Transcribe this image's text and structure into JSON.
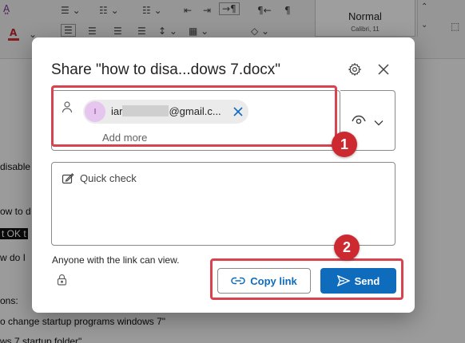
{
  "background_document": {
    "style_gallery": {
      "style_name": "Normal",
      "style_font": "Calibri, 11"
    },
    "lines": [
      {
        "text": "disable"
      },
      {
        "text": "ow to d"
      },
      {
        "text": "t OK t",
        "highlighted": true
      },
      {
        "text": "w do I"
      },
      {
        "text": "ons:"
      },
      {
        "text": "o change startup programs windows 7\""
      },
      {
        "text": "ws 7 startup folder\""
      }
    ]
  },
  "dialog": {
    "title": "Share \"how to disa...dows 7.docx\"",
    "settings_icon": "gear-icon",
    "close_icon": "close-icon",
    "recipients": {
      "chip": {
        "avatar_initial": "I",
        "email_start": "iar",
        "email_end": "@gmail.c..."
      },
      "add_more_placeholder": "Add more"
    },
    "permission": {
      "icon": "eye-icon",
      "dropdown_icon": "chevron-down-icon"
    },
    "message": {
      "placeholder": "Quick check"
    },
    "link_info": "Anyone with the link can view.",
    "buttons": {
      "copy_link": "Copy link",
      "send": "Send"
    }
  },
  "annotations": {
    "step1": "1",
    "step2": "2",
    "color": "#d9434f"
  },
  "colors": {
    "accent": "#0f6cbd",
    "avatar_bg": "#e6c5ee",
    "annotation": "#d9434f"
  }
}
